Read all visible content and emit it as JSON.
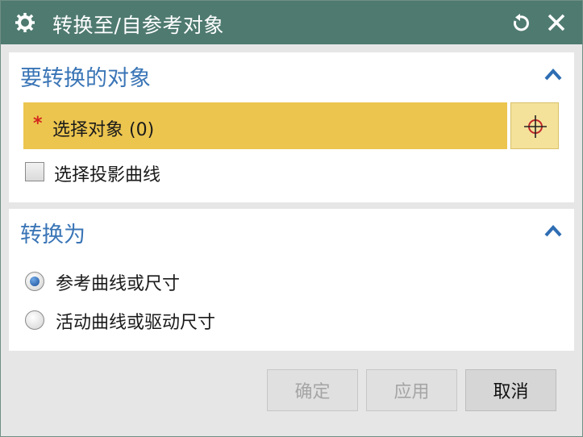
{
  "window": {
    "title": "转换至/自参考对象",
    "icons": {
      "settings": "gear-icon",
      "reset": "reset-icon",
      "close": "close-icon"
    }
  },
  "groups": [
    {
      "title": "要转换的对象",
      "select_object": {
        "required_marker": "*",
        "label": "选择对象 (0)"
      },
      "checkbox": {
        "label": "选择投影曲线",
        "checked": false
      }
    },
    {
      "title": "转换为",
      "options": [
        {
          "label": "参考曲线或尺寸",
          "selected": true
        },
        {
          "label": "活动曲线或驱动尺寸",
          "selected": false
        }
      ]
    }
  ],
  "buttons": {
    "ok": "确定",
    "apply": "应用",
    "cancel": "取消"
  },
  "colors": {
    "titlebar": "#4f7a70",
    "group_title": "#3a75b6",
    "selection_highlight": "#ecc54f",
    "required_star": "#d4261c"
  }
}
